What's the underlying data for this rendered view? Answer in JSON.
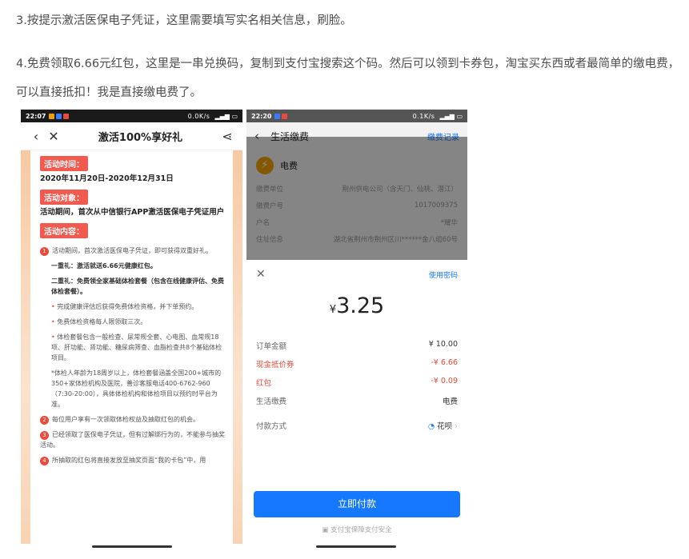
{
  "article": {
    "p1": "3.按提示激活医保电子凭证，这里需要填写实名相关信息，刷脸。",
    "p2": "4.免费领取6.66元红包，这里是一串兑换码，复制到支付宝搜索这个码。然后可以领到卡券包，淘宝买东西或者最简单的缴电费，可以直接抵扣！我是直接缴电费了。"
  },
  "left_phone": {
    "status_time": "22:07",
    "status_right": "0.0K/s",
    "title": "激活100%享好礼",
    "tag_time": "活动时间：",
    "time_value": "2020年11月20日-2020年12月31日",
    "tag_target": "活动对象：",
    "target_value": "活动期间，首次从中信银行APP激活医保电子凭证用户",
    "tag_content": "活动内容：",
    "item1": "活动期间，首次激活医保电子凭证，即可获得双重好礼。",
    "gift1": "一重礼：激活就送6.66元健康红包。",
    "gift2": "二重礼：免费领全家基础体检套餐（包含在线健康评估、免费体检套餐）。",
    "bullet1": "完成健康评估后获得免费体检资格，并下单预约。",
    "bullet2": "免费体检资格每人限领取三次。",
    "bullet3": "体检套餐包含一般检查、尿常规全套、心电图、血常规18项、肝功能、肾功能、糖尿病筛查、血脂检查共8个基础体检项目。",
    "note": "*体检人年龄为18周岁以上，体检套餐涵盖全国200+城市的350+家体检机构及医院，善诊客服电话400-6762-960（7:30-20:00），具体体检机构和体检项目以预约时平台为准。",
    "item2": "每位用户享有一次领取体检权益及抽取红包的机会。",
    "item3": "已经领取了医保电子凭证，但有过解绑行为的，不能参与抽奖活动。",
    "item4": "所抽取的红包将直接发放至抽奖页面“我的卡包”中，用"
  },
  "right_phone": {
    "status_time": "22:20",
    "status_right": "0.1K/s",
    "title": "生活缴费",
    "record_link": "缴费记录",
    "bill_type": "电费",
    "rows": [
      {
        "k": "缴费单位",
        "v": "荆州供电公司（含天门、仙桃、潜江）"
      },
      {
        "k": "缴费户号",
        "v": "1017009375"
      },
      {
        "k": "户名",
        "v": "*耀华"
      },
      {
        "k": "住址信息",
        "v": "湖北省荆州市荆州区川******金八组60号"
      }
    ],
    "use_password": "使用密码",
    "currency": "¥",
    "amount": "3.25",
    "order_label": "订单金额",
    "order_value": "¥ 10.00",
    "coupon_label": "现金抵价券",
    "coupon_value": "-¥ 6.66",
    "redpack_label": "红包",
    "redpack_value": "-¥ 0.09",
    "service_label": "生活缴费",
    "service_value": "电费",
    "paymethod_label": "付款方式",
    "paymethod_value": "花呗",
    "pay_button": "立即付款",
    "protect_text": "支付宝保障支付安全"
  },
  "colors": {
    "accent_blue": "#1677ff",
    "tag_red": "#f05a4f",
    "warn_red": "#e64a3a"
  }
}
